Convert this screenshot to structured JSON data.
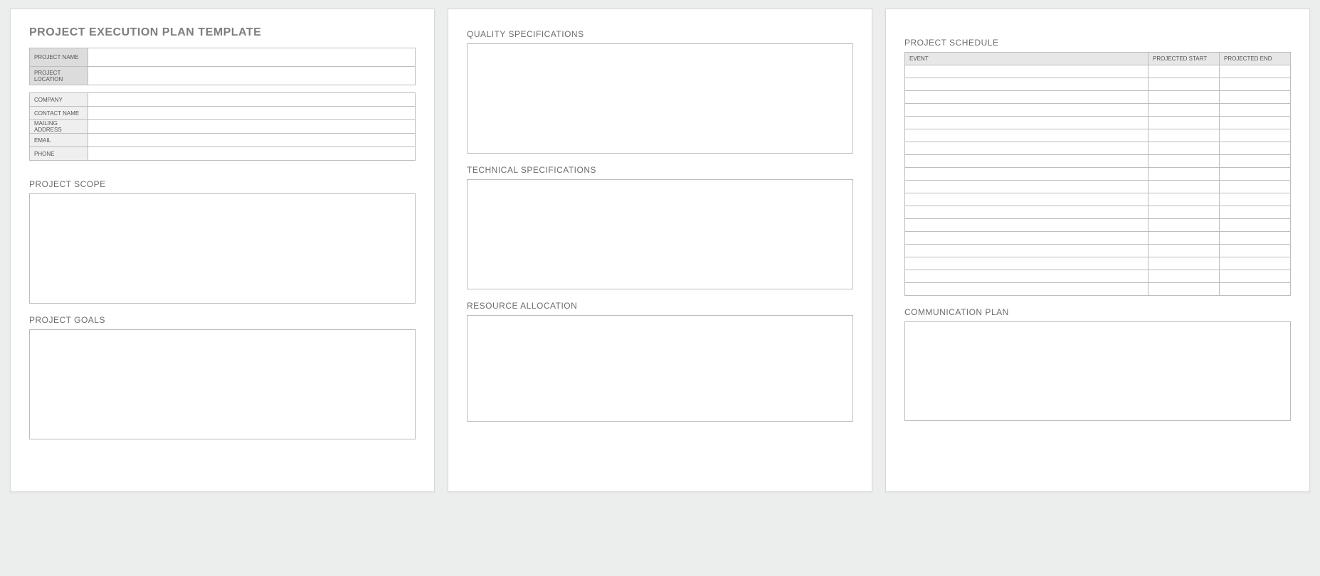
{
  "doc_title": "PROJECT EXECUTION PLAN TEMPLATE",
  "kv_header": [
    {
      "label": "PROJECT NAME",
      "value": ""
    },
    {
      "label": "PROJECT LOCATION",
      "value": ""
    }
  ],
  "kv_contact": [
    {
      "label": "COMPANY",
      "value": ""
    },
    {
      "label": "CONTACT NAME",
      "value": ""
    },
    {
      "label": "MAILING ADDRESS",
      "value": ""
    },
    {
      "label": "EMAIL",
      "value": ""
    },
    {
      "label": "PHONE",
      "value": ""
    }
  ],
  "sections": {
    "project_scope": "PROJECT SCOPE",
    "project_goals": "PROJECT GOALS",
    "quality_specs": "QUALITY SPECIFICATIONS",
    "technical_specs": "TECHNICAL SPECIFICATIONS",
    "resource_alloc": "RESOURCE ALLOCATION",
    "project_schedule": "PROJECT SCHEDULE",
    "comm_plan": "COMMUNICATION PLAN"
  },
  "schedule": {
    "headers": {
      "event": "EVENT",
      "start": "PROJECTED START",
      "end": "PROJECTED END"
    },
    "rows": [
      {
        "event": "",
        "start": "",
        "end": ""
      },
      {
        "event": "",
        "start": "",
        "end": ""
      },
      {
        "event": "",
        "start": "",
        "end": ""
      },
      {
        "event": "",
        "start": "",
        "end": ""
      },
      {
        "event": "",
        "start": "",
        "end": ""
      },
      {
        "event": "",
        "start": "",
        "end": ""
      },
      {
        "event": "",
        "start": "",
        "end": ""
      },
      {
        "event": "",
        "start": "",
        "end": ""
      },
      {
        "event": "",
        "start": "",
        "end": ""
      },
      {
        "event": "",
        "start": "",
        "end": ""
      },
      {
        "event": "",
        "start": "",
        "end": ""
      },
      {
        "event": "",
        "start": "",
        "end": ""
      },
      {
        "event": "",
        "start": "",
        "end": ""
      },
      {
        "event": "",
        "start": "",
        "end": ""
      },
      {
        "event": "",
        "start": "",
        "end": ""
      },
      {
        "event": "",
        "start": "",
        "end": ""
      },
      {
        "event": "",
        "start": "",
        "end": ""
      },
      {
        "event": "",
        "start": "",
        "end": ""
      }
    ]
  }
}
